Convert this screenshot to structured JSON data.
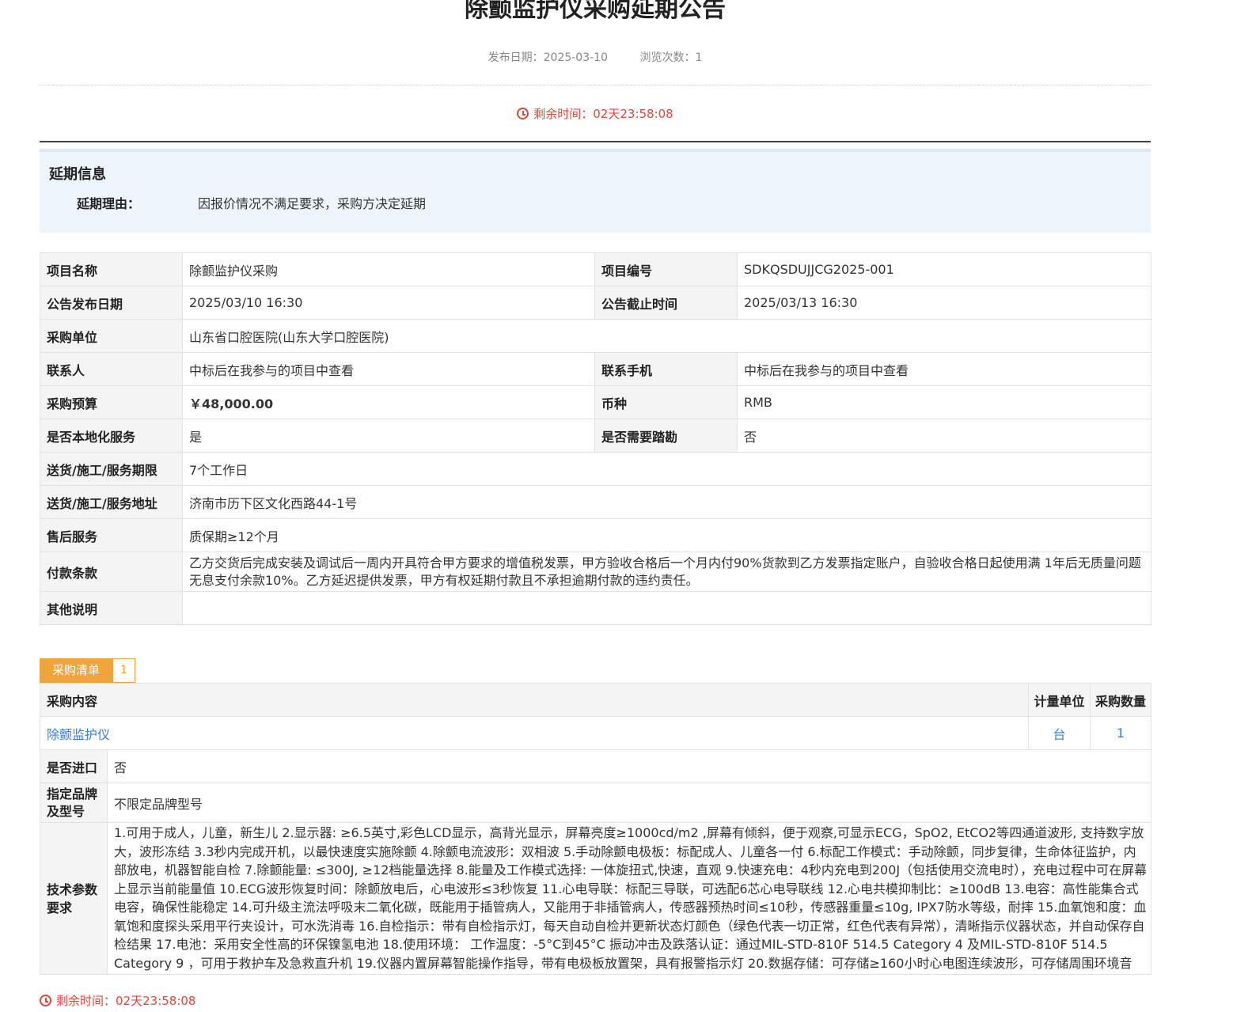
{
  "header": {
    "title": "除颤监护仪采购延期公告",
    "publish_label": "发布日期：",
    "publish_date": "2025-03-10",
    "views_label": "浏览次数：",
    "views": "1",
    "remaining_label": "剩余时间：",
    "remaining": "02天23:58:08"
  },
  "delay": {
    "title": "延期信息",
    "reason_label": "延期理由：",
    "reason": "因报价情况不满足要求，采购方决定延期"
  },
  "info": {
    "project_name_label": "项目名称",
    "project_name": "除颤监护仪采购",
    "project_no_label": "项目编号",
    "project_no": "SDKQSDUJJCG2025-001",
    "publish_label": "公告发布日期",
    "publish": "2025/03/10 16:30",
    "deadline_label": "公告截止时间",
    "deadline": "2025/03/13 16:30",
    "buyer_label": "采购单位",
    "buyer": "山东省口腔医院(山东大学口腔医院)",
    "contact_label": "联系人",
    "contact": "中标后在我参与的项目中查看",
    "phone_label": "联系手机",
    "phone": "中标后在我参与的项目中查看",
    "budget_label": "采购预算",
    "budget": "￥48,000.00",
    "currency_label": "币种",
    "currency": "RMB",
    "local_label": "是否本地化服务",
    "local": "是",
    "survey_label": "是否需要踏勘",
    "survey": "否",
    "period_label": "送货/施工/服务期限",
    "period": "7个工作日",
    "address_label": "送货/施工/服务地址",
    "address": "济南市历下区文化西路44-1号",
    "aftersale_label": "售后服务",
    "aftersale": "质保期≥12个月",
    "payment_label": "付款条款",
    "payment": "乙方交货后完成安装及调试后一周内开具符合甲方要求的增值税发票，甲方验收合格后一个月内付90%货款到乙方发票指定账户，自验收合格日起使用满 1年后无质量问题无息支付余款10%。乙方延迟提供发票，甲方有权延期付款且不承担逾期付款的违约责任。",
    "other_label": "其他说明",
    "other": ""
  },
  "purchase": {
    "tab_label": "采购清单",
    "tab_count": "1",
    "col_content": "采购内容",
    "col_unit": "计量单位",
    "col_qty": "采购数量",
    "item_name": "除颤监护仪",
    "item_unit": "台",
    "item_qty": "1",
    "import_label": "是否进口",
    "import": "否",
    "brand_label": "指定品牌及型号",
    "brand": "不限定品牌型号",
    "tech_label": "技术参数要求",
    "tech": "1.可用于成人，儿童，新生儿 2.显示器: ≥6.5英寸,彩色LCD显示，高背光显示，屏幕亮度≥1000cd/m2 ,屏幕有倾斜，便于观察,可显示ECG，SpO2, EtCO2等四通道波形, 支持数字放大，波形冻结 3.3秒内完成开机，以最快速度实施除颤 4.除颤电流波形：双相波 5.手动除颤电极板：标配成人、儿童各一付 6.标配工作模式：手动除颤，同步复律，生命体征监护，内部放电，机器智能自检 7.除颤能量: ≤300J, ≥12档能量选择 8.能量及工作模式选择: 一体旋扭式,快速，直观 9.快速充电：4秒内充电到200J（包括使用交流电时），充电过程中可在屏幕上显示当前能量值 10.ECG波形恢复时间：除颤放电后，心电波形≤3秒恢复 11.心电导联：标配三导联，可选配6芯心电导联线 12.心电共模抑制比：≥100dB 13.电容：高性能集合式电容，确保性能稳定 14.可升级主流法呼吸末二氧化碳，既能用于插管病人，又能用于非插管病人，传感器预热时间≤10秒，传感器重量≤10g, IPX7防水等级，耐摔 15.血氧饱和度：血氧饱和度探头采用平行夹设计，可水洗消毒 16.自检指示：带有自检指示灯，每天自动自检并更新状态灯颜色（绿色代表一切正常，红色代表有异常），清晰指示仪器状态，并自动保存自检结果 17.电池：采用安全性高的环保镍氢电池 18.使用环境： 工作温度：-5°C到45°C 振动冲击及跌落认证：通过MIL-STD-810F 514.5 Category 4 及MIL-STD-810F 514.5 Category 9 ，可用于救护车及急救直升机 19.仪器内置屏幕智能操作指导，带有电极板放置架，具有报警指示灯 20.数据存储：可存储≥160小时心电图连续波形，可存储周围环境音"
  },
  "footer": {
    "remaining_label": "剩余时间：",
    "remaining": "02天23:58:08"
  },
  "colors": {
    "accent_red": "#e0463a",
    "tab_orange": "#f0a43a",
    "link_blue": "#3a7fd0"
  }
}
